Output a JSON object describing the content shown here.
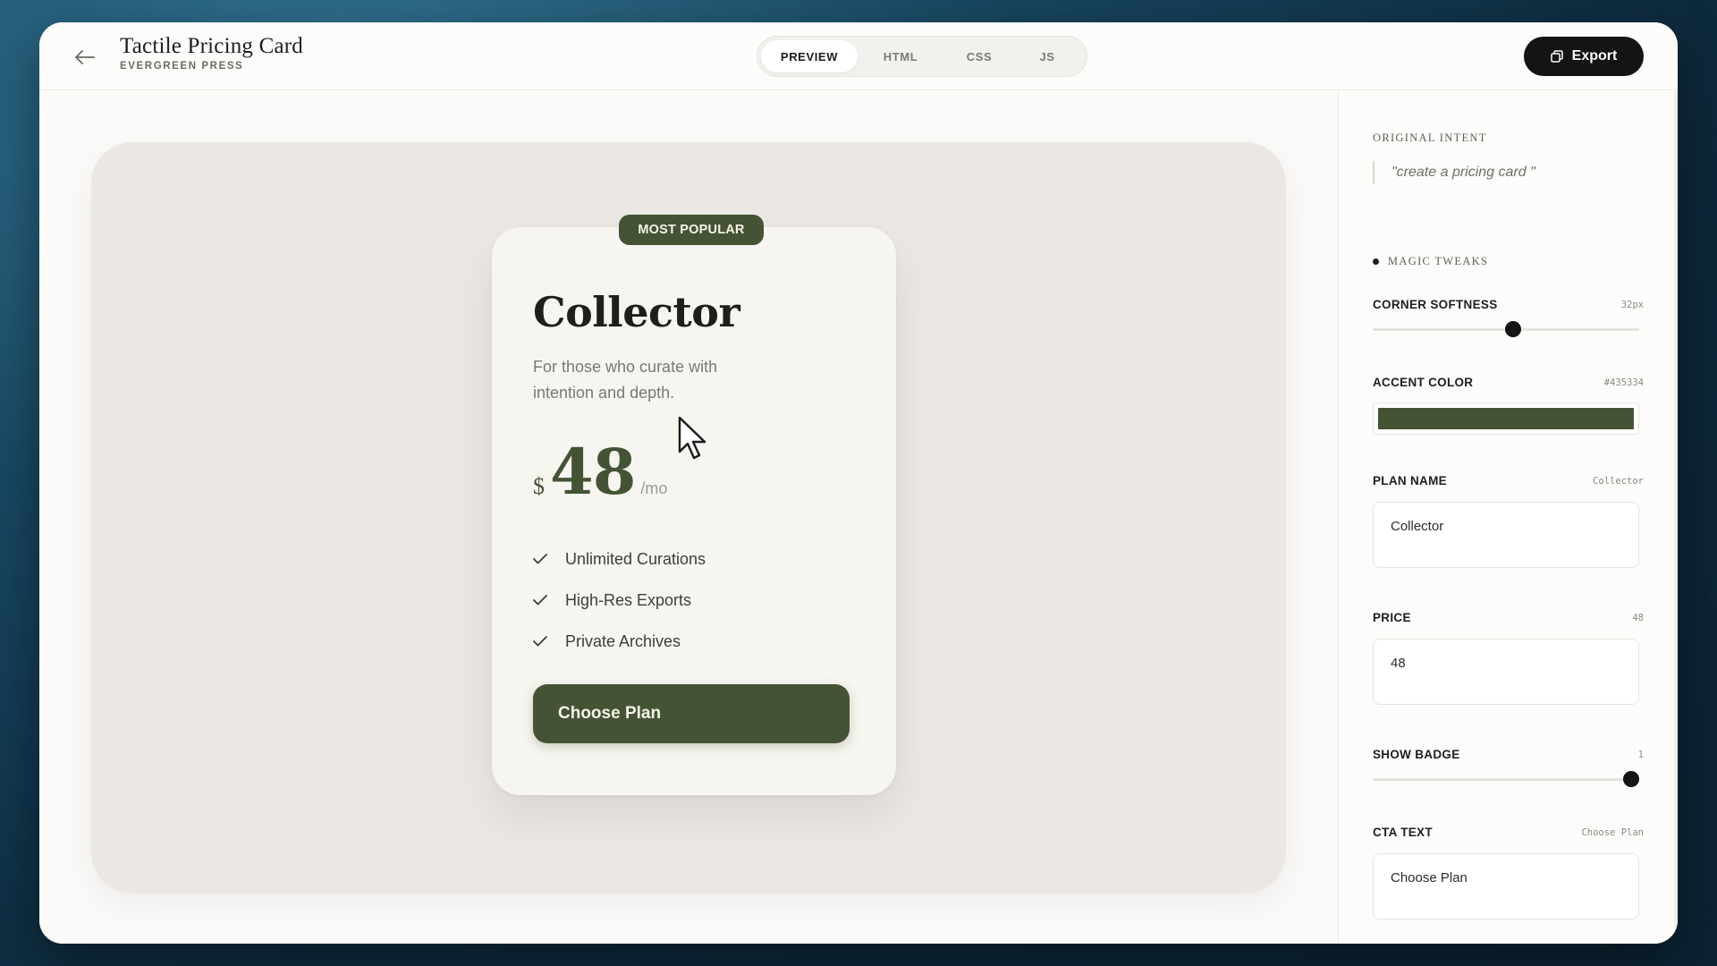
{
  "header": {
    "title": "Tactile Pricing Card",
    "subtitle": "EVERGREEN PRESS",
    "tabs": [
      {
        "label": "PREVIEW",
        "active": true
      },
      {
        "label": "HTML",
        "active": false
      },
      {
        "label": "CSS",
        "active": false
      },
      {
        "label": "JS",
        "active": false
      }
    ],
    "export_label": "Export"
  },
  "card": {
    "badge": "MOST POPULAR",
    "plan_name": "Collector",
    "description": "For those who curate with intention and depth.",
    "currency": "$",
    "price": "48",
    "period": "/mo",
    "features": [
      "Unlimited Curations",
      "High-Res Exports",
      "Private Archives"
    ],
    "cta": "Choose Plan"
  },
  "sidebar": {
    "intent_label": "ORIGINAL INTENT",
    "intent_quote": "\"create a pricing card \"",
    "tweaks_label": "MAGIC TWEAKS",
    "corner_softness": {
      "label": "CORNER SOFTNESS",
      "value": "32px",
      "fraction": 0.53
    },
    "accent_color": {
      "label": "ACCENT COLOR",
      "value": "#435334"
    },
    "plan_name": {
      "label": "PLAN NAME",
      "value": "Collector",
      "input": "Collector"
    },
    "price": {
      "label": "PRICE",
      "value": "48",
      "input": "48"
    },
    "show_badge": {
      "label": "SHOW BADGE",
      "value": "1",
      "fraction": 1.0
    },
    "cta_text": {
      "label": "CTA TEXT",
      "value": "Choose Plan",
      "input": "Choose Plan"
    }
  },
  "colors": {
    "accent": "#435334",
    "card_bg": "#f7f5f0",
    "stage_bg": "#ebe8e3",
    "export_bg": "#141414"
  },
  "icons": {
    "back": "arrow-left-icon",
    "export": "copy-icon",
    "feature": "check-icon",
    "cursor": "mouse-pointer-icon"
  }
}
